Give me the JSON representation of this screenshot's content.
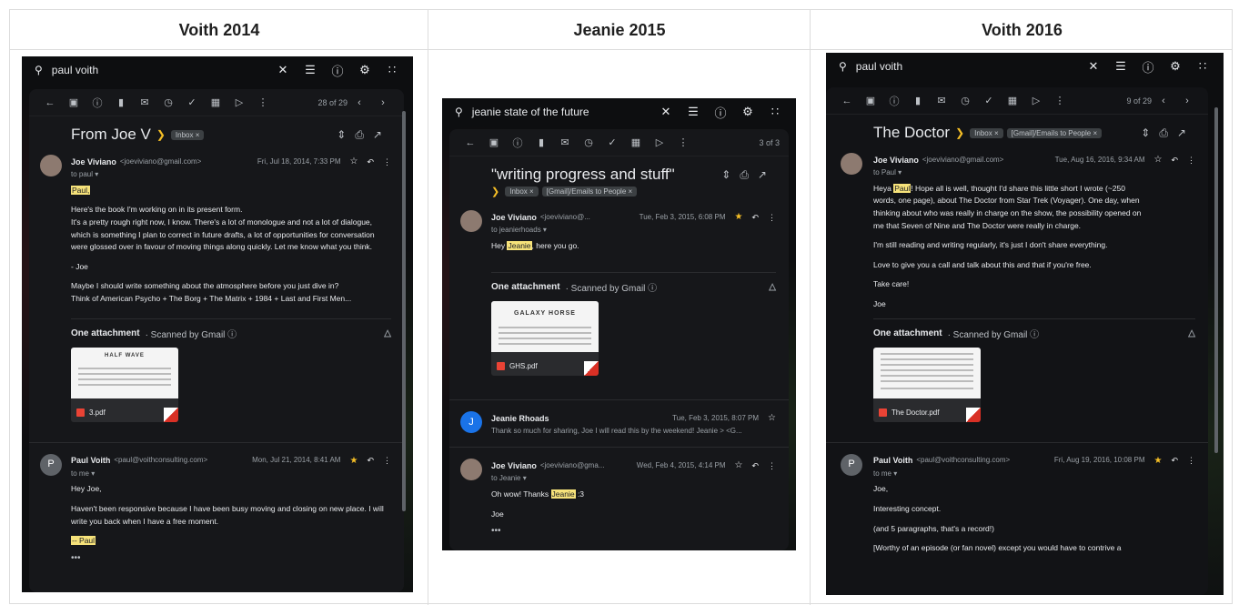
{
  "headers": [
    "Voith 2014",
    "Jeanie 2015",
    "Voith 2016"
  ],
  "shot1": {
    "search": "paul voith",
    "count": "28 of 29",
    "subject": "From Joe V",
    "chips": [
      "Inbox ×"
    ],
    "m1": {
      "avatar": "",
      "name": "Joe Viviano",
      "email": "<joeviviano@gmail.com>",
      "date": "Fri, Jul 18, 2014, 7:33 PM",
      "to": "to paul ▾",
      "greeting": "Paul,",
      "p1": "Here's the book I'm working on in its present form.",
      "p2": "It's a pretty rough right now, I know. There's a lot of monologue and not a lot of dialogue, which is something I plan to correct in future drafts, a lot of opportunities for conversation were glossed over in favour of moving things along quickly. Let me know what you think.",
      "p3": "- Joe",
      "p4": "Maybe I should write something about the atmosphere before you just dive in?",
      "p5": "Think of American Psycho + The Borg + The Matrix + 1984 + Last and First Men..."
    },
    "attach": {
      "label": "One attachment",
      "scan": "· Scanned by Gmail ⓘ",
      "file": "3.pdf",
      "thumb_title": "HALF WAVE"
    },
    "m2": {
      "avatar": "P",
      "name": "Paul Voith",
      "email": "<paul@voithconsulting.com>",
      "date": "Mon, Jul 21, 2014, 8:41 AM",
      "to": "to me ▾",
      "p1": "Hey Joe,",
      "p2": "Haven't been responsive because I have been busy moving and closing on new place. I will write you back when I have a free moment.",
      "p3": "-- Paul",
      "more": "•••"
    }
  },
  "shot2": {
    "search": "jeanie state of the future",
    "count": "3 of 3",
    "subject": "\"writing progress and stuff\"",
    "chips": [
      "Inbox ×",
      "[Gmail]/Emails to People ×"
    ],
    "m1": {
      "name": "Joe Viviano",
      "email": "<joeviviano@...",
      "date": "Tue, Feb 3, 2015, 6:08 PM",
      "to": "to jeanierhoads ▾",
      "p1a": "Hey ",
      "p1h": "Jeanie",
      "p1b": ", here you go."
    },
    "attach": {
      "label": "One attachment",
      "scan": "· Scanned by Gmail ⓘ",
      "file": "GHS.pdf",
      "thumb_title": "GALAXY HORSE"
    },
    "m2": {
      "avatar": "J",
      "name": "Jeanie Rhoads",
      "date": "Tue, Feb 3, 2015, 8:07 PM",
      "snippet": "Thank so much for sharing, Joe I will read this by the weekend! Jeanie > <G..."
    },
    "m3": {
      "name": "Joe Viviano",
      "email": "<joeviviano@gma...",
      "date": "Wed, Feb 4, 2015, 4:14 PM",
      "to": "to Jeanie ▾",
      "p1a": "Oh wow! Thanks ",
      "p1h": "Jeanie",
      "p1b": " :3",
      "p2": "Joe",
      "more": "•••"
    }
  },
  "shot3": {
    "search": "paul voith",
    "count": "9 of 29",
    "subject": "The Doctor",
    "chips": [
      "Inbox ×",
      "[Gmail]/Emails to People ×"
    ],
    "m1": {
      "name": "Joe Viviano",
      "email": "<joeviviano@gmail.com>",
      "date": "Tue, Aug 16, 2016, 9:34 AM",
      "to": "to Paul ▾",
      "p1a": "Heya ",
      "p1h": "Paul",
      "p1b": "! Hope all is well, thought I'd share this little short I wrote (~250 words, one page), about The Doctor from Star Trek (Voyager). One day, when thinking about who was really in charge on the show, the possibility opened on me that Seven of Nine and The Doctor were really in charge.",
      "p2": "I'm still reading and writing regularly, it's just I don't share everything.",
      "p3": "Love to give you a call and talk about this and that if you're free.",
      "p4": "Take care!",
      "p5": "Joe"
    },
    "attach": {
      "label": "One attachment",
      "scan": "· Scanned by Gmail ⓘ",
      "file": "The Doctor.pdf"
    },
    "m2": {
      "avatar": "P",
      "name": "Paul Voith",
      "email": "<paul@voithconsulting.com>",
      "date": "Fri, Aug 19, 2016, 10:08 PM",
      "to": "to me ▾",
      "p1": "Joe,",
      "p2": "Interesting concept.",
      "p3": "(and 5 paragraphs, that's a record!)",
      "p4": "[Worthy of an episode (or fan novel) except you would have to contrive a"
    }
  }
}
